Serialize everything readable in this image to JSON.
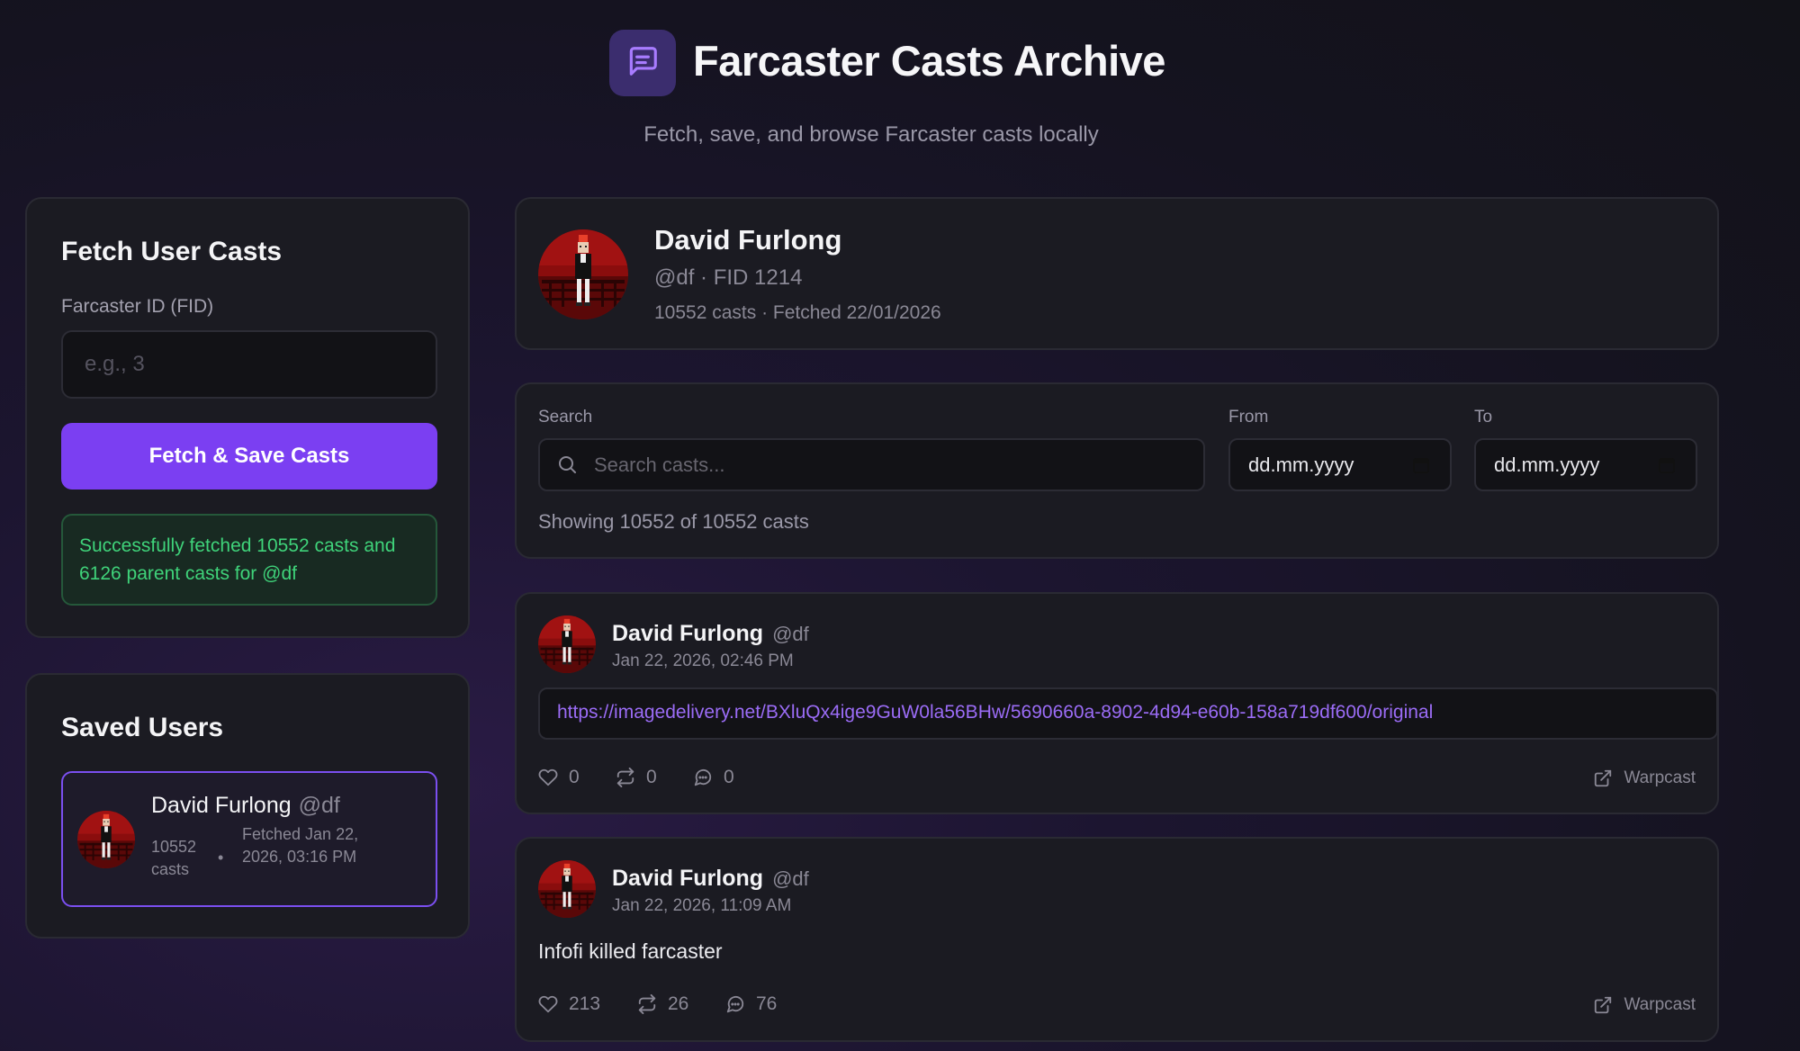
{
  "header": {
    "title": "Farcaster Casts Archive",
    "subtitle": "Fetch, save, and browse Farcaster casts locally",
    "logo_icon": "message-square-icon",
    "accent": "#7b3ff2"
  },
  "fetch_panel": {
    "title": "Fetch User Casts",
    "fid_label": "Farcaster ID (FID)",
    "fid_placeholder": "e.g., 3",
    "fid_value": "",
    "button_label": "Fetch & Save Casts",
    "success_message": "Successfully fetched 10552 casts and 6126 parent casts for @df"
  },
  "saved_users": {
    "title": "Saved Users",
    "items": [
      {
        "name": "David Furlong",
        "handle": "@df",
        "casts_count": "10552",
        "casts_word": "casts",
        "separator": "•",
        "fetched": "Fetched Jan 22, 2026, 03:16 PM"
      }
    ]
  },
  "profile": {
    "name": "David Furlong",
    "handle_fid": "@df · FID 1214",
    "meta": "10552 casts · Fetched 22/01/2026"
  },
  "filters": {
    "search_label": "Search",
    "search_placeholder": "Search casts...",
    "search_value": "",
    "from_label": "From",
    "from_value": "dd.mm.yyyy",
    "to_label": "To",
    "to_value": "dd.mm.yyyy",
    "showing_text": "Showing 10552 of 10552 casts"
  },
  "casts": [
    {
      "author": "David Furlong",
      "handle": "@df",
      "date": "Jan 22, 2026, 02:46 PM",
      "link": "https://imagedelivery.net/BXluQx4ige9GuW0la56BHw/5690660a-8902-4d94-e60b-158a719df600/original",
      "text": "",
      "likes": "0",
      "recasts": "0",
      "replies": "0",
      "warpcast_label": "Warpcast"
    },
    {
      "author": "David Furlong",
      "handle": "@df",
      "date": "Jan 22, 2026, 11:09 AM",
      "link": "",
      "text": "Infofi killed farcaster",
      "likes": "213",
      "recasts": "26",
      "replies": "76",
      "warpcast_label": "Warpcast"
    }
  ],
  "icons": {
    "like": "heart-icon",
    "recast": "repeat-icon",
    "reply": "message-circle-icon",
    "external": "external-link-icon",
    "search": "search-icon",
    "calendar": "calendar-icon"
  }
}
